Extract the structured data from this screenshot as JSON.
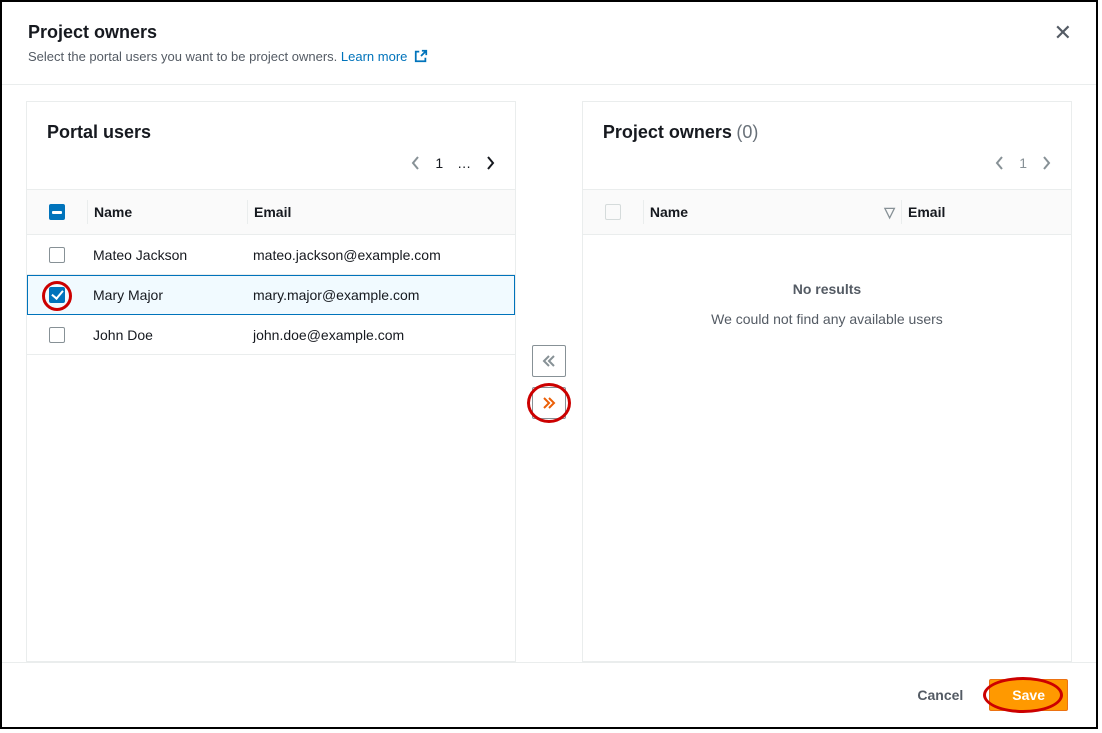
{
  "header": {
    "title": "Project owners",
    "subtitle": "Select the portal users you want to be project owners.",
    "learn_more": "Learn more"
  },
  "left_panel": {
    "title": "Portal users",
    "pager": {
      "current": "1",
      "ellipsis": "…"
    },
    "th_name": "Name",
    "th_email": "Email",
    "rows": [
      {
        "name": "Mateo Jackson",
        "email": "mateo.jackson@example.com",
        "checked": false
      },
      {
        "name": "Mary Major",
        "email": "mary.major@example.com",
        "checked": true
      },
      {
        "name": "John Doe",
        "email": "john.doe@example.com",
        "checked": false
      }
    ]
  },
  "right_panel": {
    "title": "Project owners",
    "count": "(0)",
    "pager": {
      "current": "1"
    },
    "th_name": "Name",
    "th_email": "Email",
    "empty_title": "No results",
    "empty_msg": "We could not find any available users"
  },
  "footer": {
    "cancel": "Cancel",
    "save": "Save"
  }
}
